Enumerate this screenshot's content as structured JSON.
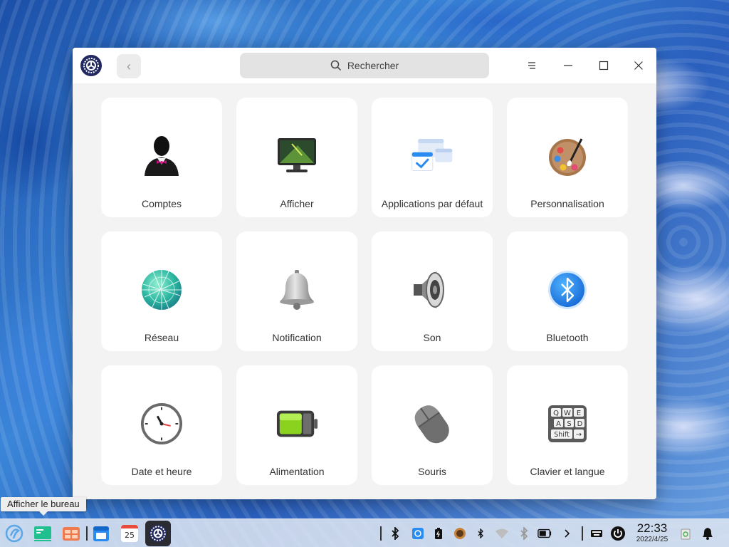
{
  "window": {
    "search_placeholder": "Rechercher",
    "back_label": "‹"
  },
  "modules": [
    {
      "label": "Comptes",
      "icon": "user-account-icon"
    },
    {
      "label": "Afficher",
      "icon": "display-monitor-icon"
    },
    {
      "label": "Applications par défaut",
      "icon": "default-apps-icon"
    },
    {
      "label": "Personnalisation",
      "icon": "palette-icon"
    },
    {
      "label": "Réseau",
      "icon": "network-globe-icon"
    },
    {
      "label": "Notification",
      "icon": "bell-icon"
    },
    {
      "label": "Son",
      "icon": "speaker-icon"
    },
    {
      "label": "Bluetooth",
      "icon": "bluetooth-icon"
    },
    {
      "label": "Date et heure",
      "icon": "clock-icon"
    },
    {
      "label": "Alimentation",
      "icon": "battery-icon"
    },
    {
      "label": "Souris",
      "icon": "mouse-icon"
    },
    {
      "label": "Clavier et langue",
      "icon": "keyboard-icon"
    }
  ],
  "keyboard_keys": [
    "Q",
    "W",
    "E",
    "A",
    "S",
    "D",
    "Shift",
    "→"
  ],
  "tooltip": "Afficher le bureau",
  "taskbar": {
    "calendar_day": "25",
    "clock_time": "22:33",
    "clock_date": "2022/4/25"
  },
  "colors": {
    "accent_blue": "#2a8cf0",
    "window_bg": "#f3f3f3",
    "card_bg": "#ffffff"
  }
}
